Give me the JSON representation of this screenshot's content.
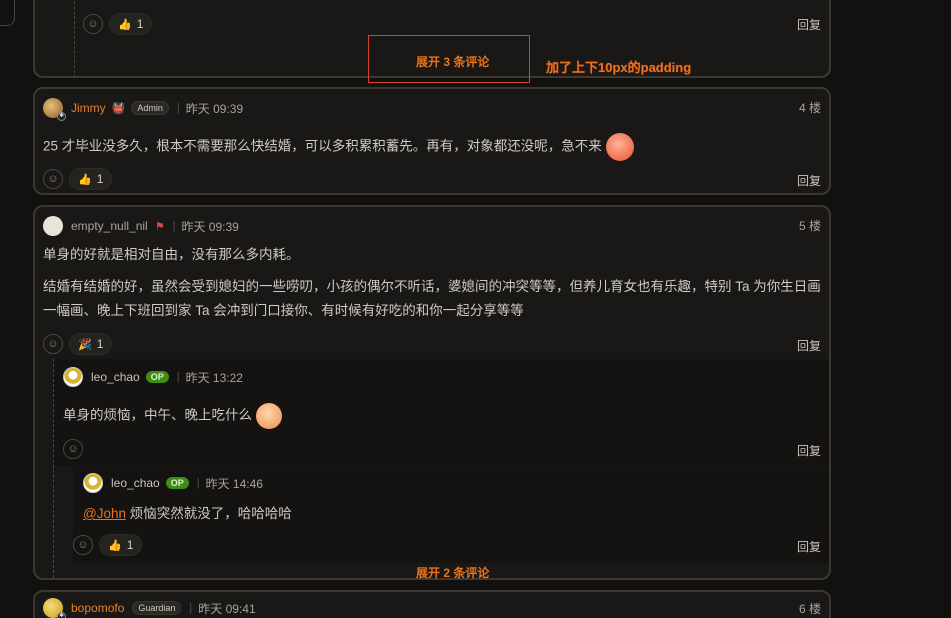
{
  "colors": {
    "accent": "#e8731c",
    "background": "#121110",
    "card": "#191816",
    "op_badge": "#3f8c18",
    "annotation_border": "#d2442a"
  },
  "top": {
    "reaction_count": "1",
    "reply_label": "回复",
    "expand_label": "展开 3 条评论"
  },
  "annotation": {
    "text": "加了上下10px的padding"
  },
  "comments": [
    {
      "username": "Jimmy",
      "role_icon": "demon-mask-icon",
      "badge": "Admin",
      "time": "昨天 09:39",
      "floor": "4 楼",
      "body": "25 才毕业没多久，根本不需要那么快结婚，可以多积累积蓄先。再有，对象都还没呢，急不来",
      "reaction_icon": "thumbs-up-icon",
      "reaction_count": "1",
      "reply_label": "回复"
    },
    {
      "username": "empty_null_nil",
      "role_icon": "red-flag-icon",
      "time": "昨天 09:39",
      "floor": "5 楼",
      "body_lines": [
        "单身的好就是相对自由，没有那么多内耗。",
        "结婚有结婚的好，虽然会受到媳妇的一些唠叨，小孩的偶尔不听话，婆媳间的冲突等等，但养儿育女也有乐趣，特别 Ta 为你生日画一幅画、晚上下班回到家 Ta 会冲到门口接你、有时候有好吃的和你一起分享等等"
      ],
      "reaction_icon": "party-popper-icon",
      "reaction_count": "1",
      "reply_label": "回复",
      "expand_label": "展开 2 条评论",
      "replies": [
        {
          "username": "leo_chao",
          "badge": "OP",
          "time": "昨天 13:22",
          "body": "单身的烦恼，中午、晚上吃什么",
          "reply_label": "回复"
        },
        {
          "username": "leo_chao",
          "badge": "OP",
          "time": "昨天 14:46",
          "mention": "@John",
          "body": "烦恼突然就没了，哈哈哈哈",
          "reaction_icon": "thumbs-up-icon",
          "reaction_count": "1",
          "reply_label": "回复"
        }
      ]
    },
    {
      "username": "bopomofo",
      "badge": "Guardian",
      "time": "昨天 09:41",
      "floor": "6 楼"
    }
  ]
}
